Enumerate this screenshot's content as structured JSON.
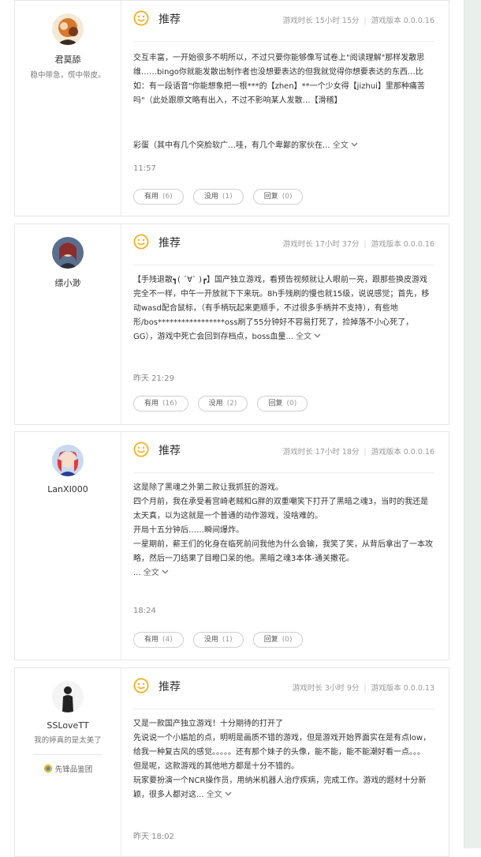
{
  "reviews": [
    {
      "user": {
        "name": "君莫舔",
        "signature": "稳中带急，慌中带皮。"
      },
      "rec_label": "推荐",
      "playtime": "游戏时长 15小时 15分",
      "version": "游戏版本 0.0.0.16",
      "paragraphs": [
        "交互丰富，一开始很多不明所以，不过只要你能够像写试卷上\"阅读理解\"那样发散思维……bingo你就能发散出制作者也没想要表达的但我就觉得你想要表达的东西…比如：有一段语音\"你能想象把一根***的【zhen】**一个少女得【jizhui】里那种痛苦吗\"（此处跟原文略有出入，不过不影响某人发散…【滑稽】"
      ],
      "trailing_text": "彩蛋（其中有几个突脸软广…哇，有几个卑鄙的家伙在...",
      "more_label": "全文",
      "time": "11:57",
      "buttons": {
        "useful": "有用",
        "useful_count": "(6)",
        "useless": "没用",
        "useless_count": "(1)",
        "reply": "回复",
        "reply_count": "(0)"
      }
    },
    {
      "user": {
        "name": "缥小渺",
        "signature": ""
      },
      "rec_label": "推荐",
      "playtime": "游戏时长 17小时 37分",
      "version": "游戏版本 0.0.0.16",
      "paragraphs": [
        "【手残退散┓( ´∀` )┏】国产独立游戏，看预告视频就让人眼前一亮，跟那些换皮游戏完全不一样，中午一开放就下下来玩。8h手残刷的慢也就15级，说说感觉；首先，移动wasd配合鼠标，（有手柄玩起来更顺手，不过很多手柄并不支持），有些地形/bos*****************oss刷了55分钟好不容易打死了，捡掉落不小心死了，GG），游戏中死亡会回到存档点，boss血量..."
      ],
      "trailing_text": "",
      "more_label": "全文",
      "time": "昨天 21:29",
      "buttons": {
        "useful": "有用",
        "useful_count": "(16)",
        "useless": "没用",
        "useless_count": "(2)",
        "reply": "回复",
        "reply_count": "(0)"
      }
    },
    {
      "user": {
        "name": "LanXI000",
        "signature": ""
      },
      "rec_label": "推荐",
      "playtime": "游戏时长 17小时 18分",
      "version": "游戏版本 0.0.0.16",
      "paragraphs": [
        "这是除了黑魂之外第二款让我抓狂的游戏。",
        "四个月前，我在承受着宫崎老贼和G胖的双重嘲笑下打开了黑暗之魂3，当时的我还是太天真，以为这就是一个普通的动作游戏，没啥难的。",
        "开局十五分钟后……瞬间爆炸。",
        "一星期前，薪王们的化身在临死前问我他为什么会输，我笑了笑，从背后拿出了一本攻略，然后一刀结果了目瞪口呆的他。黑暗之魂3本体-通关撒花。"
      ],
      "trailing_text": "...",
      "more_label": "全文",
      "time": "18:24",
      "buttons": {
        "useful": "有用",
        "useful_count": "(4)",
        "useless": "没用",
        "useless_count": "(1)",
        "reply": "回复",
        "reply_count": "(0)"
      }
    },
    {
      "user": {
        "name": "SSLoveTT",
        "signature": "我的婷真的是太美了",
        "badge": "先锋品鉴团"
      },
      "rec_label": "推荐",
      "playtime": "游戏时长 3小时 9分",
      "version": "游戏版本 0.0.0.13",
      "paragraphs": [
        "又是一款国产独立游戏！十分期待的打开了",
        "先说说一个小尴尬的点，明明是画质不错的游戏，但是游戏开始界面实在是有点low，给我一种复古风的感觉。。。。。还有那个妹子的头像，能不能，能不能潮好看一点。。。",
        "但是呢，这款游戏的其他地方都是十分不错的。",
        "玩家要扮演一个NCR操作员，用纳米机器人治疗疾病，完成工作。游戏的题材十分新颖，很多人都对这..."
      ],
      "trailing_text": "",
      "more_label": "全文",
      "time": "昨天 18:02",
      "buttons": null
    }
  ]
}
